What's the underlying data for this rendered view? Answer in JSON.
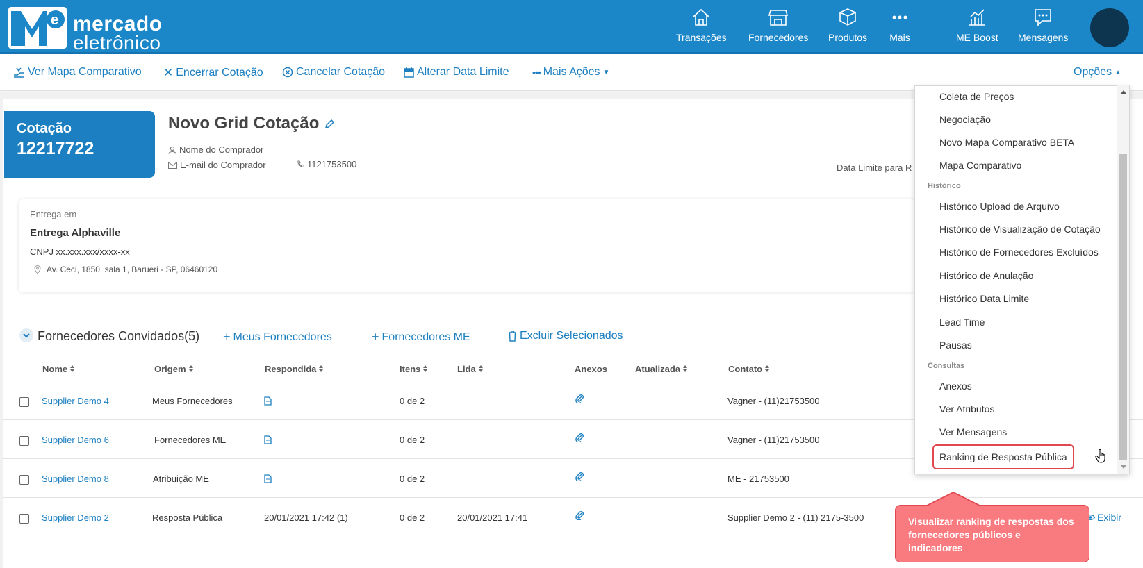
{
  "brand": {
    "line1": "mercado",
    "line2": "eletrônico"
  },
  "nav": [
    {
      "label": "Transações",
      "icon": "home-icon"
    },
    {
      "label": "Fornecedores",
      "icon": "store-icon"
    },
    {
      "label": "Produtos",
      "icon": "box-icon"
    },
    {
      "label": "Mais",
      "icon": "more-icon"
    },
    {
      "label": "ME Boost",
      "icon": "chart-icon"
    },
    {
      "label": "Mensagens",
      "icon": "message-icon"
    }
  ],
  "actions": {
    "mapa": "Ver Mapa Comparativo",
    "encerrar": "Encerrar Cotação",
    "cancelar": "Cancelar Cotação",
    "alterar": "Alterar Data Limite",
    "mais": "Mais Ações",
    "opcoes": "Opções"
  },
  "cotacao": {
    "label": "Cotação",
    "number": "12217722"
  },
  "title": "Novo Grid Cotação",
  "buyer": {
    "name": "Nome do Comprador",
    "email": "E-mail do Comprador",
    "phone": "1121753500"
  },
  "data_limite": "Data Limite para R",
  "entrega": {
    "label": "Entrega em",
    "name": "Entrega Alphaville",
    "cnpj": "CNPJ xx.xxx.xxx/xxxx-xx",
    "address": "Av. Ceci, 1850, sala 1, Barueri - SP, 06460120"
  },
  "fornecedores": {
    "title": "Fornecedores Convidados(5)",
    "meus": "Meus Fornecedores",
    "me": "Fornecedores ME",
    "excluir": "Excluir Selecionados"
  },
  "columns": [
    "Nome",
    "Origem",
    "Respondida",
    "Itens",
    "Lida",
    "Anexos",
    "Atualizada",
    "Contato"
  ],
  "rows": [
    {
      "nome": "Supplier Demo 4",
      "origem": "Meus Fornecedores",
      "respondida": "",
      "itens": "0 de 2",
      "lida": "",
      "contato": "Vagner - (11)21753500"
    },
    {
      "nome": "Supplier Demo 6",
      "origem": "Fornecedores ME",
      "respondida": "",
      "itens": "0 de 2",
      "lida": "",
      "contato": "Vagner - (11)21753500"
    },
    {
      "nome": "Supplier Demo 8",
      "origem": "Atribuição ME",
      "respondida": "",
      "itens": "0 de 2",
      "lida": "",
      "contato": "ME - 21753500"
    },
    {
      "nome": "Supplier Demo 2",
      "origem": "Resposta Pública",
      "respondida": "20/01/2021 17:42 (1)",
      "itens": "0 de 2",
      "lida": "20/01/2021 17:41",
      "contato": "Supplier Demo 2 - (11) 2175-3500"
    }
  ],
  "exibir": "Exibir",
  "dropdown": {
    "items_top": [
      "Coleta de Preços",
      "Negociação",
      "Novo Mapa Comparativo BETA",
      "Mapa Comparativo"
    ],
    "head_historico": "Histórico",
    "items_hist": [
      "Histórico Upload de Arquivo",
      "Histórico de Visualização de Cotação",
      "Histórico de Fornecedores Excluídos",
      "Histórico de Anulação",
      "Histórico Data Limite",
      "Lead Time",
      "Pausas"
    ],
    "head_consultas": "Consultas",
    "items_cons": [
      "Anexos",
      "Ver Atributos",
      "Ver Mensagens"
    ],
    "highlighted": "Ranking de Resposta Pública"
  },
  "tooltip": "Visualizar ranking de respostas dos fornecedores públicos e indicadores",
  "colors": {
    "brand_blue": "#1b87c9",
    "link_blue": "#1b7fc1",
    "alert_red": "#e0484f",
    "tooltip_bg": "#f97b80"
  }
}
